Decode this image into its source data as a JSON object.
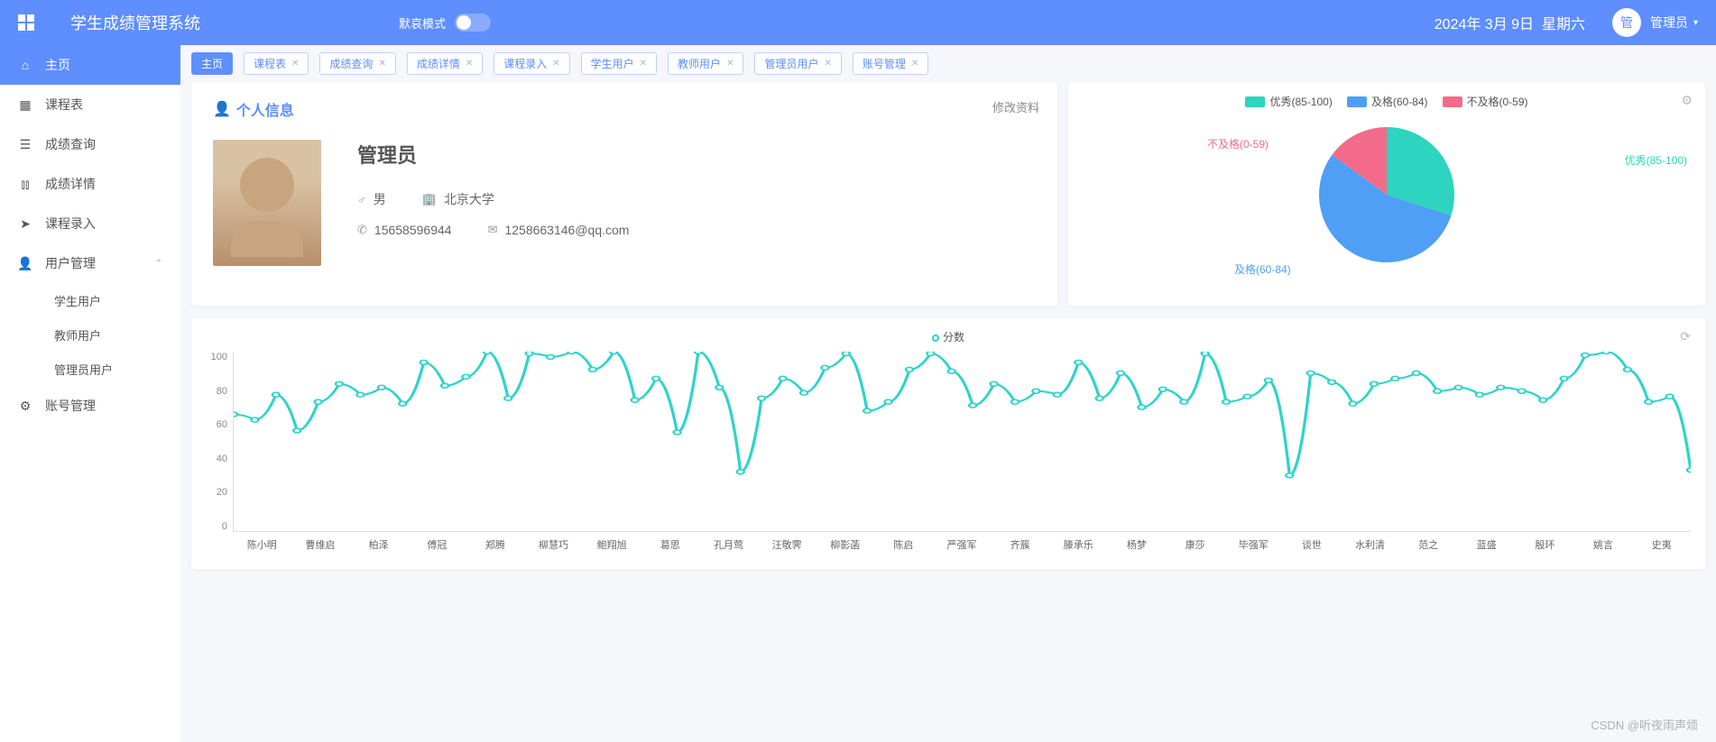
{
  "header": {
    "title": "学生成绩管理系统",
    "dark_mode_label": "默哀模式",
    "date": "2024年 3月 9日",
    "weekday": "星期六",
    "avatar_char": "管",
    "user_name": "管理员"
  },
  "sidebar": {
    "items": [
      {
        "label": "主页",
        "icon": "home",
        "active": true
      },
      {
        "label": "课程表",
        "icon": "grid"
      },
      {
        "label": "成绩查询",
        "icon": "list"
      },
      {
        "label": "成绩详情",
        "icon": "bars"
      },
      {
        "label": "课程录入",
        "icon": "send"
      },
      {
        "label": "用户管理",
        "icon": "user",
        "expanded": true,
        "children": [
          "学生用户",
          "教师用户",
          "管理员用户"
        ]
      },
      {
        "label": "账号管理",
        "icon": "gear"
      }
    ]
  },
  "tabs": [
    "主页",
    "课程表",
    "成绩查询",
    "成绩详情",
    "课程录入",
    "学生用户",
    "教师用户",
    "管理员用户",
    "账号管理"
  ],
  "profile": {
    "card_title": "个人信息",
    "edit_label": "修改资料",
    "name": "管理员",
    "gender": "男",
    "school": "北京大学",
    "phone": "15658596944",
    "email": "1258663146@qq.com"
  },
  "chart_data": [
    {
      "type": "pie",
      "title": "",
      "series": [
        {
          "name": "优秀(85-100)",
          "value": 30,
          "color": "#2dd4bf"
        },
        {
          "name": "及格(60-84)",
          "value": 55,
          "color": "#4e9ff5"
        },
        {
          "name": "不及格(0-59)",
          "value": 15,
          "color": "#f26b8a"
        }
      ]
    },
    {
      "type": "line",
      "legend": "分数",
      "ylim": [
        0,
        100
      ],
      "yticks": [
        0,
        20,
        40,
        60,
        80,
        100
      ],
      "categories": [
        "陈小明",
        "曹维启",
        "柏泽",
        "傅冠",
        "郑腾",
        "柳慧巧",
        "鲍翔旭",
        "葛思",
        "孔月莺",
        "汪敬霁",
        "柳影菡",
        "陈启",
        "严强军",
        "齐簇",
        "滕承乐",
        "杨梦",
        "康莎",
        "毕强军",
        "谈世",
        "水利清",
        "范之",
        "蓝盛",
        "殷环",
        "姚言",
        "史夷"
      ],
      "values": [
        65,
        62,
        76,
        56,
        72,
        82,
        76,
        80,
        71,
        94,
        81,
        86,
        100,
        74,
        99,
        97,
        100,
        90,
        100,
        73,
        85,
        55,
        100,
        80,
        33,
        74,
        85,
        77,
        91,
        99,
        67,
        72,
        90,
        99,
        89,
        70,
        82,
        72,
        78,
        76,
        94,
        74,
        88,
        69,
        79,
        72,
        99,
        72,
        75,
        84,
        31,
        88,
        83,
        71,
        82,
        85,
        88,
        78,
        80,
        76,
        80,
        78,
        73,
        85,
        98,
        100,
        90,
        72,
        75,
        34
      ],
      "points_per_category": 2.8
    }
  ],
  "watermark": "CSDN @听夜雨声烦"
}
